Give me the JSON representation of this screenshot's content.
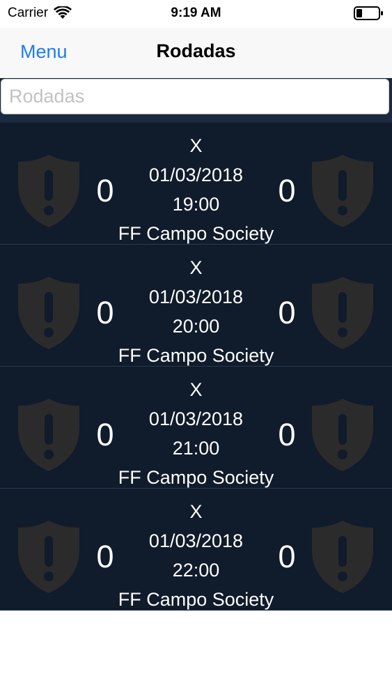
{
  "status_bar": {
    "carrier": "Carrier",
    "time": "9:19 AM"
  },
  "nav": {
    "menu_label": "Menu",
    "title": "Rodadas"
  },
  "search": {
    "placeholder": "Rodadas",
    "value": ""
  },
  "matches": [
    {
      "home_score": "0",
      "away_score": "0",
      "versus": "X",
      "date": "01/03/2018",
      "time": "19:00",
      "venue": "FF Campo Society"
    },
    {
      "home_score": "0",
      "away_score": "0",
      "versus": "X",
      "date": "01/03/2018",
      "time": "20:00",
      "venue": "FF Campo Society"
    },
    {
      "home_score": "0",
      "away_score": "0",
      "versus": "X",
      "date": "01/03/2018",
      "time": "21:00",
      "venue": "FF Campo Society"
    },
    {
      "home_score": "0",
      "away_score": "0",
      "versus": "X",
      "date": "01/03/2018",
      "time": "22:00",
      "venue": "FF Campo Society"
    }
  ],
  "icons": {
    "wifi": "wifi-icon",
    "battery": "battery-icon",
    "crest": "shield-exclamation-icon"
  },
  "colors": {
    "accent": "#1e7cf2",
    "row_background": "#101b2b",
    "search_background": "#1b2a40",
    "crest": "#2b2b2b"
  }
}
